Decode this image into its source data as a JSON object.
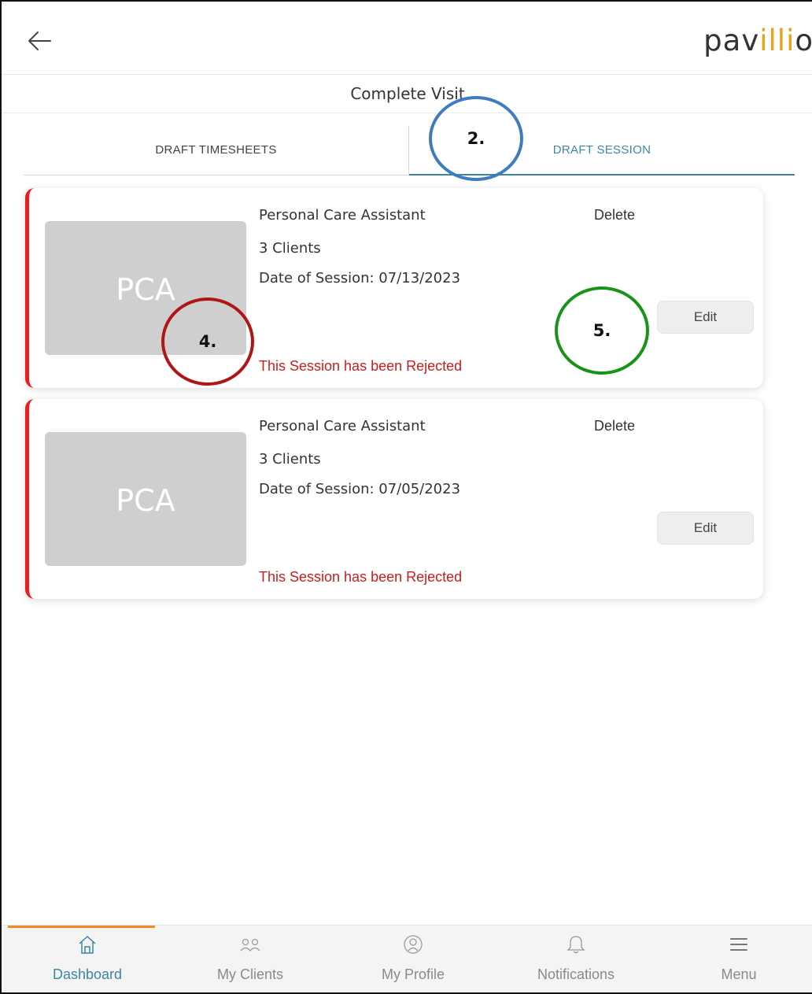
{
  "app": {
    "logo_text_start": "pav",
    "logo_text_mid": "illi",
    "logo_text_end": "o",
    "page_subtitle": "Complete Visit"
  },
  "tabs": [
    {
      "label": "DRAFT TIMESHEETS",
      "active": false
    },
    {
      "label": "DRAFT SESSION",
      "active": true
    }
  ],
  "sessions": [
    {
      "thumb_label": "PCA",
      "title": "Personal Care Assistant",
      "clients": "3 Clients",
      "date": "Date of Session: 07/13/2023",
      "status": "This Session has been Rejected",
      "delete_label": "Delete",
      "edit_label": "Edit"
    },
    {
      "thumb_label": "PCA",
      "title": "Personal Care Assistant",
      "clients": "3 Clients",
      "date": "Date of Session: 07/05/2023",
      "status": "This Session has been Rejected",
      "delete_label": "Delete",
      "edit_label": "Edit"
    }
  ],
  "annotations": [
    {
      "label": "2.",
      "color": "#3f7cbf"
    },
    {
      "label": "4.",
      "color": "#b01616"
    },
    {
      "label": "5.",
      "color": "#199319"
    }
  ],
  "bottom_nav": [
    {
      "label": "Dashboard",
      "icon": "home-icon",
      "active": true
    },
    {
      "label": "My Clients",
      "icon": "clients-icon",
      "active": false
    },
    {
      "label": "My Profile",
      "icon": "profile-icon",
      "active": false
    },
    {
      "label": "Notifications",
      "icon": "bell-icon",
      "active": false
    },
    {
      "label": "Menu",
      "icon": "menu-icon",
      "active": false
    }
  ],
  "colors": {
    "accent": "#3c86a5",
    "rejected": "#c81d1d",
    "card_border": "#ee1c1c",
    "nav_active_bar": "#f08a24",
    "logo_accent": "#e8a317"
  }
}
